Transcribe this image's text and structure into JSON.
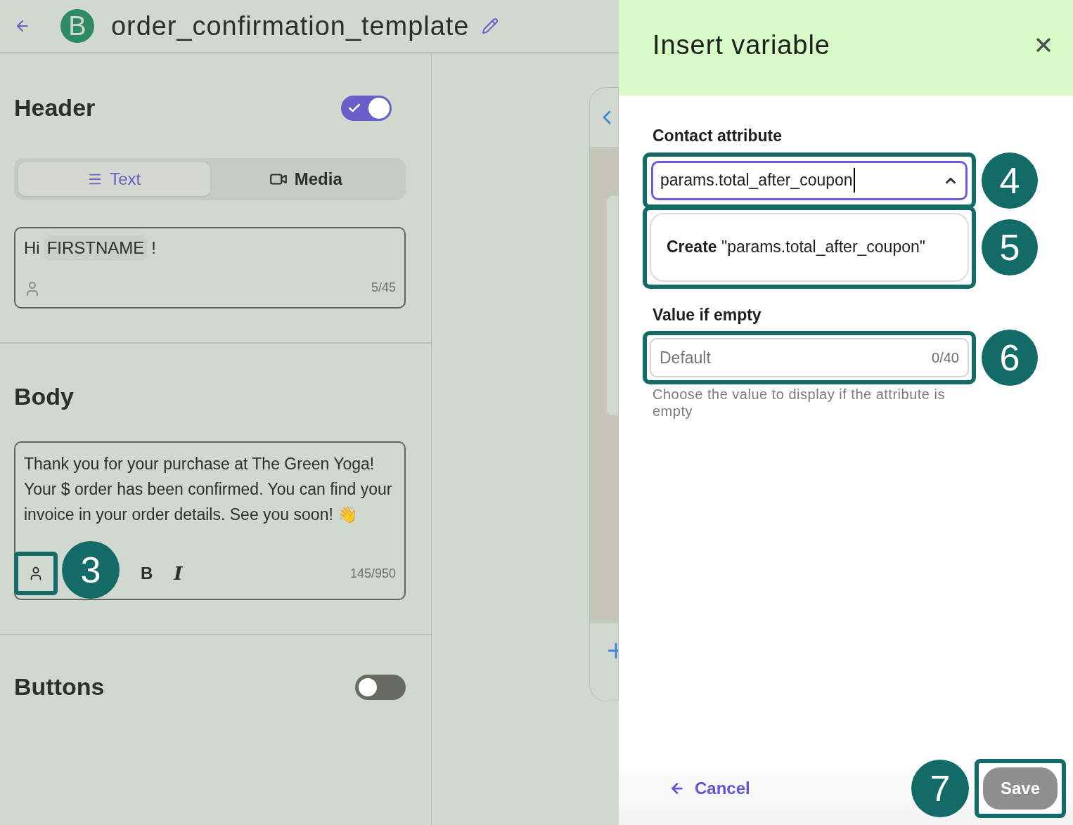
{
  "top_bar": {
    "title": "order_confirmation_template",
    "logo_letter": "B"
  },
  "header_section": {
    "title": "Header",
    "on": true,
    "tabs": [
      {
        "label": "Text",
        "selected": true,
        "kind": "text"
      },
      {
        "label": "Media",
        "selected": false,
        "kind": "media"
      }
    ],
    "field": {
      "greeting": "Hi",
      "variable": "FIRSTNAME",
      "punctuation": "!",
      "count": "5/45"
    }
  },
  "body_section": {
    "title": "Body",
    "text": "Thank you for your purchase at The Green Yoga! Your $ order has been confirmed. You can find your invoice in your order details. See you soon! 👋",
    "count": "145/950",
    "bold_label": "B",
    "italic_label": "I",
    "callout": "3"
  },
  "buttons_section": {
    "title": "Buttons",
    "on": false
  },
  "drawer": {
    "title": "Insert variable",
    "contact_attribute": {
      "label": "Contact attribute",
      "value": "params.total_after_coupon",
      "expanded": true,
      "callout": "4"
    },
    "create_option": {
      "action": "Create",
      "value": "\"params.total_after_coupon\"",
      "callout": "5"
    },
    "value_if_empty": {
      "label": "Value if empty",
      "placeholder": "Default",
      "count": "0/40",
      "hint": "Choose the value to display if the attribute is empty",
      "callout": "6"
    },
    "cancel": "Cancel",
    "save": {
      "label": "Save",
      "disabled": true,
      "callout": "7"
    }
  }
}
